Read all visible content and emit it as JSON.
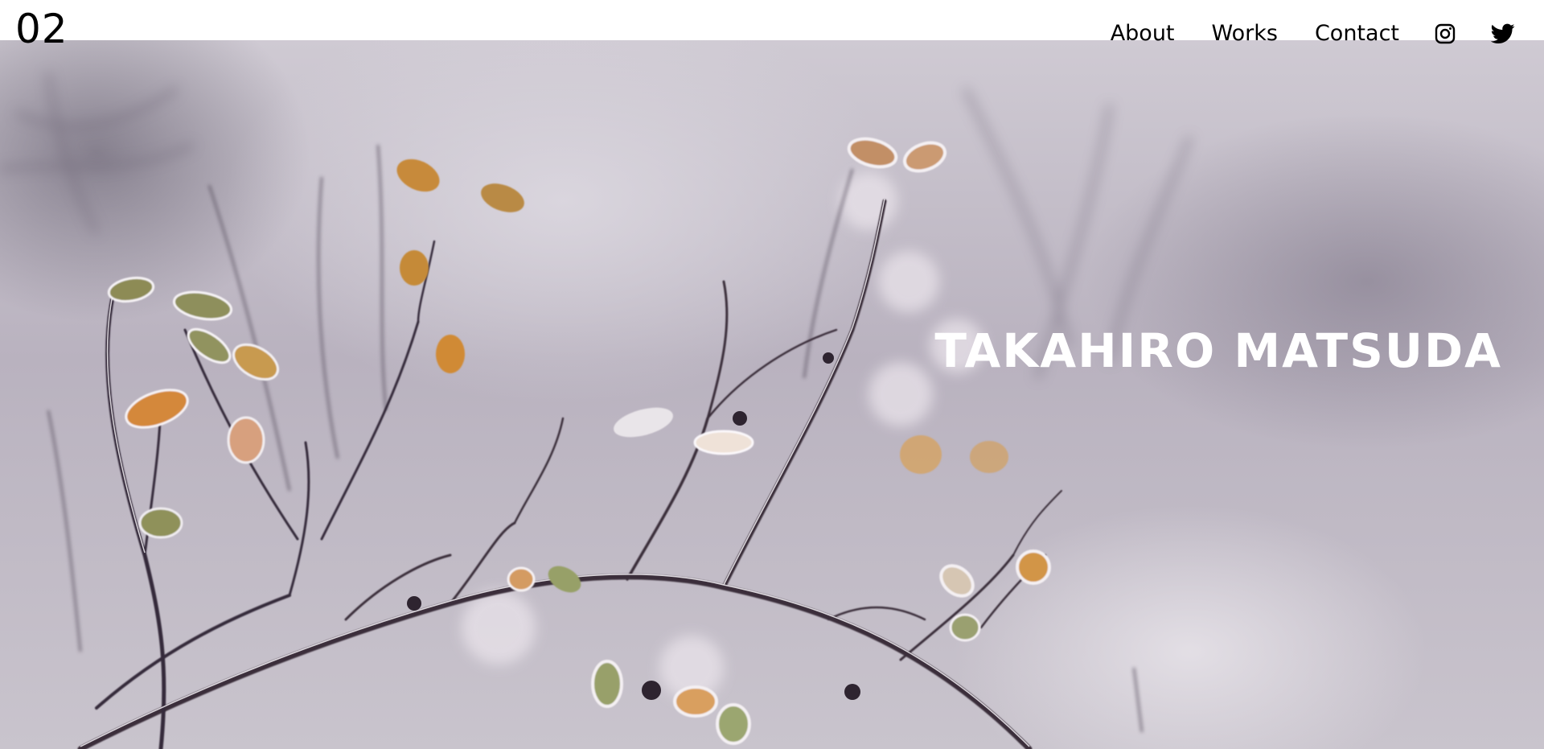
{
  "header": {
    "logo_text": "02"
  },
  "nav": {
    "items": [
      {
        "label": "About"
      },
      {
        "label": "Works"
      },
      {
        "label": "Contact"
      }
    ],
    "icons": [
      "instagram-icon",
      "twitter-icon"
    ]
  },
  "hero": {
    "title": "TAKAHIRO MATSUDA",
    "image": "frosted-branches-photo"
  },
  "colors": {
    "header_bg": "#ffffff",
    "text": "#000000",
    "hero_title": "#ffffff"
  }
}
